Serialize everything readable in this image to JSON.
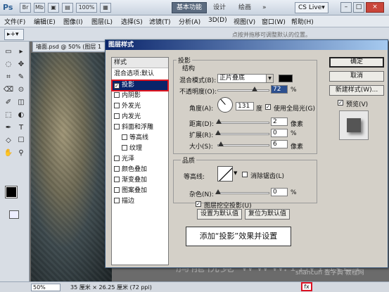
{
  "app": {
    "logo": "Ps"
  },
  "titlebar": {
    "icon_labels": [
      "Br",
      "Mb",
      "▣",
      "▤",
      "100%",
      "▦"
    ],
    "workspace_buttons": [
      "基本功能",
      "设计",
      "绘画",
      "»"
    ],
    "cs_live": "CS Live▾",
    "window_buttons": [
      "–",
      "□",
      "×"
    ]
  },
  "menu": [
    "文件(F)",
    "编辑(E)",
    "图像(I)",
    "图层(L)",
    "选择(S)",
    "滤镜(T)",
    "分析(A)",
    "3D(D)",
    "视图(V)",
    "窗口(W)",
    "帮助(H)"
  ],
  "options_bar": {
    "tool": "▸+▾",
    "hint": "点按并拖移可调整默认的位置。"
  },
  "document": {
    "tab_title": "墙面.psd @ 50% (图层 1",
    "zoom": "50%",
    "doc_size": "35 厘米 × 26.25 厘米 (72 ppi)"
  },
  "tools": [
    "▭",
    "▸",
    "◌",
    "✥",
    "⌗",
    "✎",
    "⌫",
    "⊙",
    "✐",
    "◫",
    "⬚",
    "◐",
    "✒",
    "T",
    "◇",
    "☐",
    "✋",
    "⚲"
  ],
  "dialog": {
    "title": "图层样式",
    "style_list": {
      "header": "样式",
      "blend": "混合选项:默认",
      "items": [
        {
          "label": "投影",
          "checked": true,
          "selected": true
        },
        {
          "label": "内阴影",
          "checked": false
        },
        {
          "label": "外发光",
          "checked": false
        },
        {
          "label": "内发光",
          "checked": false
        },
        {
          "label": "斜面和浮雕",
          "checked": false
        },
        {
          "label": "等高线",
          "checked": false,
          "indent": true
        },
        {
          "label": "纹理",
          "checked": false,
          "indent": true
        },
        {
          "label": "光泽",
          "checked": false
        },
        {
          "label": "颜色叠加",
          "checked": false
        },
        {
          "label": "渐变叠加",
          "checked": false
        },
        {
          "label": "图案叠加",
          "checked": false
        },
        {
          "label": "描边",
          "checked": false
        }
      ]
    },
    "shadow_section": "投影",
    "structure": {
      "label": "结构",
      "blend_mode_label": "混合模式(B):",
      "blend_mode_value": "正片叠底",
      "shadow_color": "#000000",
      "opacity_label": "不透明度(O):",
      "opacity_value": "72",
      "opacity_fraction": 0.72,
      "angle_label": "角度(A):",
      "angle_value": "131",
      "angle_unit": "度",
      "global_light_label": "使用全局光(G)",
      "global_light_checked": true,
      "distance_label": "距离(D):",
      "distance_value": "2",
      "distance_fraction": 0.02,
      "spread_label": "扩展(R):",
      "spread_value": "0",
      "spread_fraction": 0,
      "size_label": "大小(S):",
      "size_value": "6",
      "size_fraction": 0.06,
      "unit_px": "像素",
      "unit_pct": "%"
    },
    "quality": {
      "label": "品质",
      "contour_label": "等高线:",
      "antialias_label": "消除锯齿(L)",
      "antialias_checked": false,
      "noise_label": "杂色(N):",
      "noise_value": "0",
      "noise_fraction": 0,
      "knockout_label": "图层挖空投影(U)",
      "knockout_checked": true
    },
    "buttons": {
      "make_default": "设置为默认值",
      "reset_default": "复位为默认值",
      "ok": "确定",
      "cancel": "取消",
      "new_style": "新建样式(W)...",
      "preview_label": "预览(V)",
      "preview_checked": true
    }
  },
  "callout": "添加“投影”效果并设置",
  "watermark": "腾龍視覺 WWW.TLVI.NET",
  "watermark_small": "shancun 查字典 教程网"
}
